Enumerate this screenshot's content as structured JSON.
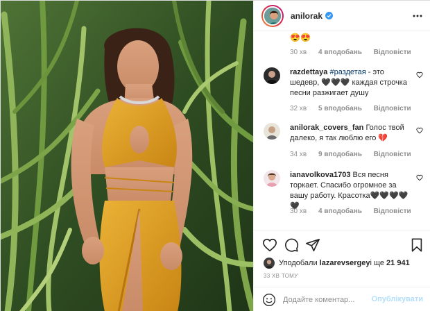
{
  "header": {
    "username": "anilorak",
    "verified_icon": "verified-badge-icon",
    "more_icon": "more-options-icon"
  },
  "comments": {
    "partial_emoji": "😍😍",
    "partial_meta": {
      "time": "30 хв",
      "likes": "4 вподобань",
      "reply": "Відповісти"
    },
    "items": [
      {
        "username": "razdettaya",
        "tag": "#раздетая",
        "text": " - это шедевр, 🖤🖤🖤 каждая строчка песни разжигает душу",
        "time": "32 хв",
        "likes": "5 вподобань",
        "reply": "Відповісти"
      },
      {
        "username": "anilorak_covers_fan",
        "tag": "",
        "text": " Голос твой далеко, я так люблю его 💔",
        "time": "34 хв",
        "likes": "9 вподобань",
        "reply": "Відповісти"
      },
      {
        "username": "ianavolkova1703",
        "tag": "",
        "text": " Вся песня торкает. Спасибо огромное за вашу работу. Красотка🖤🖤🖤🖤🖤",
        "time": "30 хв",
        "likes": "4 вподобань",
        "reply": "Відповісти"
      }
    ]
  },
  "actions": {
    "like_icon": "heart-icon",
    "comment_icon": "comment-icon",
    "share_icon": "share-icon",
    "save_icon": "bookmark-icon"
  },
  "likes": {
    "prefix": "Уподобали ",
    "user": "lazarevsergey",
    "middle": " і ще ",
    "count": "21 941"
  },
  "timestamp": "33 хв тому",
  "add_comment": {
    "placeholder": "Додайте коментар...",
    "post_label": "Опублікувати"
  },
  "colors": {
    "accent": "#0095f6",
    "post_disabled": "#b2dffc",
    "verified": "#3897f0",
    "dress": "#d99a1e"
  }
}
